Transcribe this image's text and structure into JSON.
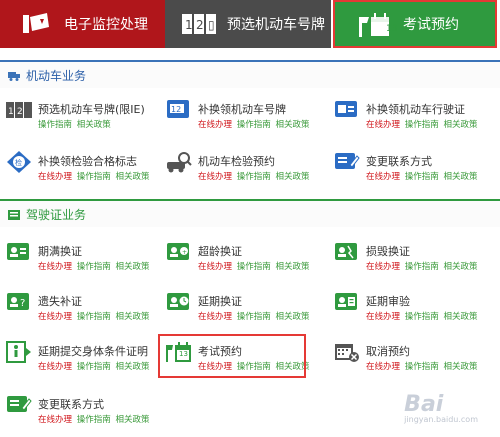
{
  "top_tabs": [
    {
      "label": "电子监控处理",
      "icon": "camera-icon"
    },
    {
      "label": "预选机动车号牌",
      "icon": "plate-icon"
    },
    {
      "label": "考试预约",
      "icon": "calendar-icon",
      "badge": "13"
    }
  ],
  "sections": [
    {
      "title": "机动车业务",
      "icon": "truck-icon"
    },
    {
      "title": "驾驶证业务",
      "icon": "card-icon"
    }
  ],
  "links": {
    "online": "在线办理",
    "guide": "操作指南",
    "policy": "相关政策"
  },
  "vehicle_items": [
    {
      "title": "预选机动车号牌(限IE)",
      "icon": "plate-icon",
      "guide_only": true
    },
    {
      "title": "补换领机动车号牌",
      "icon": "plate-replace-icon"
    },
    {
      "title": "补换领机动车行驶证",
      "icon": "license-replace-icon"
    },
    {
      "title": "补换领检验合格标志",
      "icon": "inspection-mark-icon"
    },
    {
      "title": "机动车检验预约",
      "icon": "car-inspect-icon"
    },
    {
      "title": "变更联系方式",
      "icon": "contact-edit-icon"
    }
  ],
  "license_items": [
    {
      "title": "期满换证",
      "icon": "renew-icon"
    },
    {
      "title": "超龄换证",
      "icon": "age-renew-icon"
    },
    {
      "title": "损毁换证",
      "icon": "damage-renew-icon"
    },
    {
      "title": "遗失补证",
      "icon": "lost-icon"
    },
    {
      "title": "延期换证",
      "icon": "defer-renew-icon"
    },
    {
      "title": "延期审验",
      "icon": "defer-review-icon"
    },
    {
      "title": "延期提交身体条件证明",
      "icon": "health-icon"
    },
    {
      "title": "考试预约",
      "icon": "exam-icon",
      "badge": "13"
    },
    {
      "title": "取消预约",
      "icon": "cancel-icon"
    },
    {
      "title": "变更联系方式",
      "icon": "contact-edit-icon"
    }
  ],
  "colors": {
    "red": "#b0161b",
    "gray": "#4b4b4b",
    "green": "#2f9a3f",
    "blue": "#2b5fa8"
  },
  "watermark": {
    "main": "Bai",
    "sub": "jingyan.baidu.com"
  }
}
